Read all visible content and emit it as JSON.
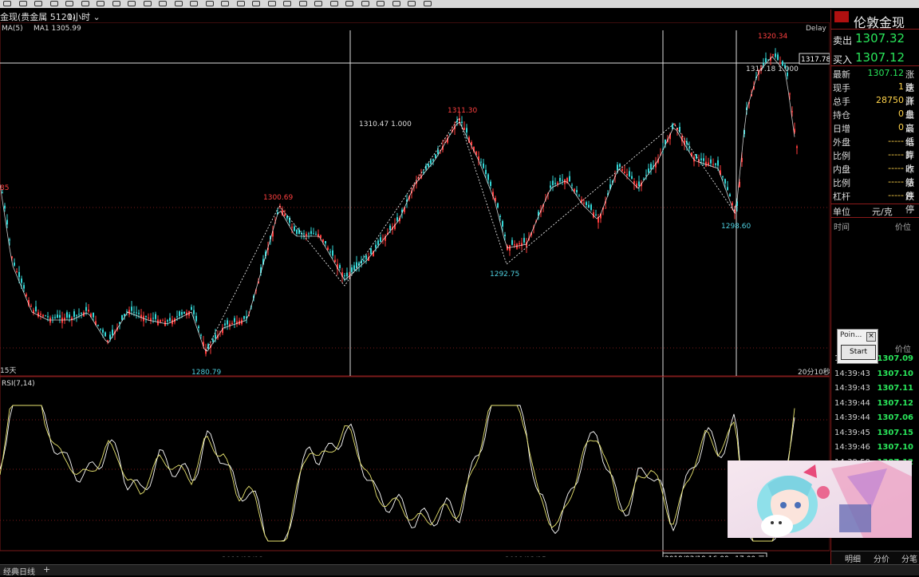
{
  "toolbar": {
    "icon_count": 28
  },
  "header": {
    "symbol": "金现(贵金属 5120)",
    "timeframe": "1小时",
    "indicator_label": "MA(5)",
    "ma_value": "MA1 1305.99",
    "delay": "Delay"
  },
  "chart": {
    "price_annotations": {
      "high_label": "1320.34",
      "left_label": "85",
      "p1300": "1300.69",
      "p1311": "1311.30",
      "p1292": "1292.75",
      "p1298": "1298.60",
      "p1280": "1280.79",
      "crosshair_price": "1317.78",
      "marker_a": "1310.47  1.000",
      "marker_b": "1317.18  1.000"
    },
    "left_bottom_label": "15天",
    "right_bottom_label": "20分10秒",
    "rsi_label": "RSI(7,14)",
    "x_labels": [
      "2019/03/08",
      "2019/03/15"
    ],
    "cursor_date": "2019/03/19 16:00~17:00 二",
    "colors": {
      "up": "#ff3b3b",
      "down": "#34d6d6",
      "rsi1": "#ffffff",
      "rsi2": "#e8e470",
      "grid": "#7a1a1a"
    }
  },
  "sidebar": {
    "title": "伦敦金现",
    "sell_label": "卖出",
    "sell_price": "1307.32",
    "buy_label": "买入",
    "buy_price": "1307.12",
    "rows": [
      {
        "label": "最新",
        "value": "1307.12",
        "label2": "涨跌"
      },
      {
        "label": "现手",
        "value": "1",
        "label2": "速涨"
      },
      {
        "label": "总手",
        "value": "28750",
        "label2": "开盘"
      },
      {
        "label": "持仓",
        "value": "0",
        "label2": "最高"
      },
      {
        "label": "日增",
        "value": "0",
        "label2": "最低"
      },
      {
        "label": "外盘",
        "value": "-----",
        "label2": "结算"
      },
      {
        "label": "比例",
        "value": "-----",
        "label2": "昨收"
      },
      {
        "label": "内盘",
        "value": "-----",
        "label2": "昨结"
      },
      {
        "label": "比例",
        "value": "-----",
        "label2": "涨停"
      },
      {
        "label": "杠杆",
        "value": "-----",
        "label2": "跌停"
      }
    ],
    "unit_label": "单位",
    "unit_value": "元/克",
    "time_header": "时间",
    "price_header": "价位",
    "price_header2": "价位",
    "ticks": [
      {
        "time": "14:39:43",
        "price": "1307.09"
      },
      {
        "time": "14:39:43",
        "price": "1307.10"
      },
      {
        "time": "14:39:43",
        "price": "1307.11"
      },
      {
        "time": "14:39:44",
        "price": "1307.12"
      },
      {
        "time": "14:39:44",
        "price": "1307.06"
      },
      {
        "time": "14:39:45",
        "price": "1307.15"
      },
      {
        "time": "14:39:46",
        "price": "1307.10"
      },
      {
        "time": "14:39:50",
        "price": "1307.12"
      }
    ],
    "tabs": [
      "明细",
      "分价",
      "分笔"
    ]
  },
  "popup": {
    "title": "Poin...",
    "close": "×",
    "button": "Start"
  },
  "statusbar": {
    "text": "经典日线",
    "plus": "+"
  }
}
